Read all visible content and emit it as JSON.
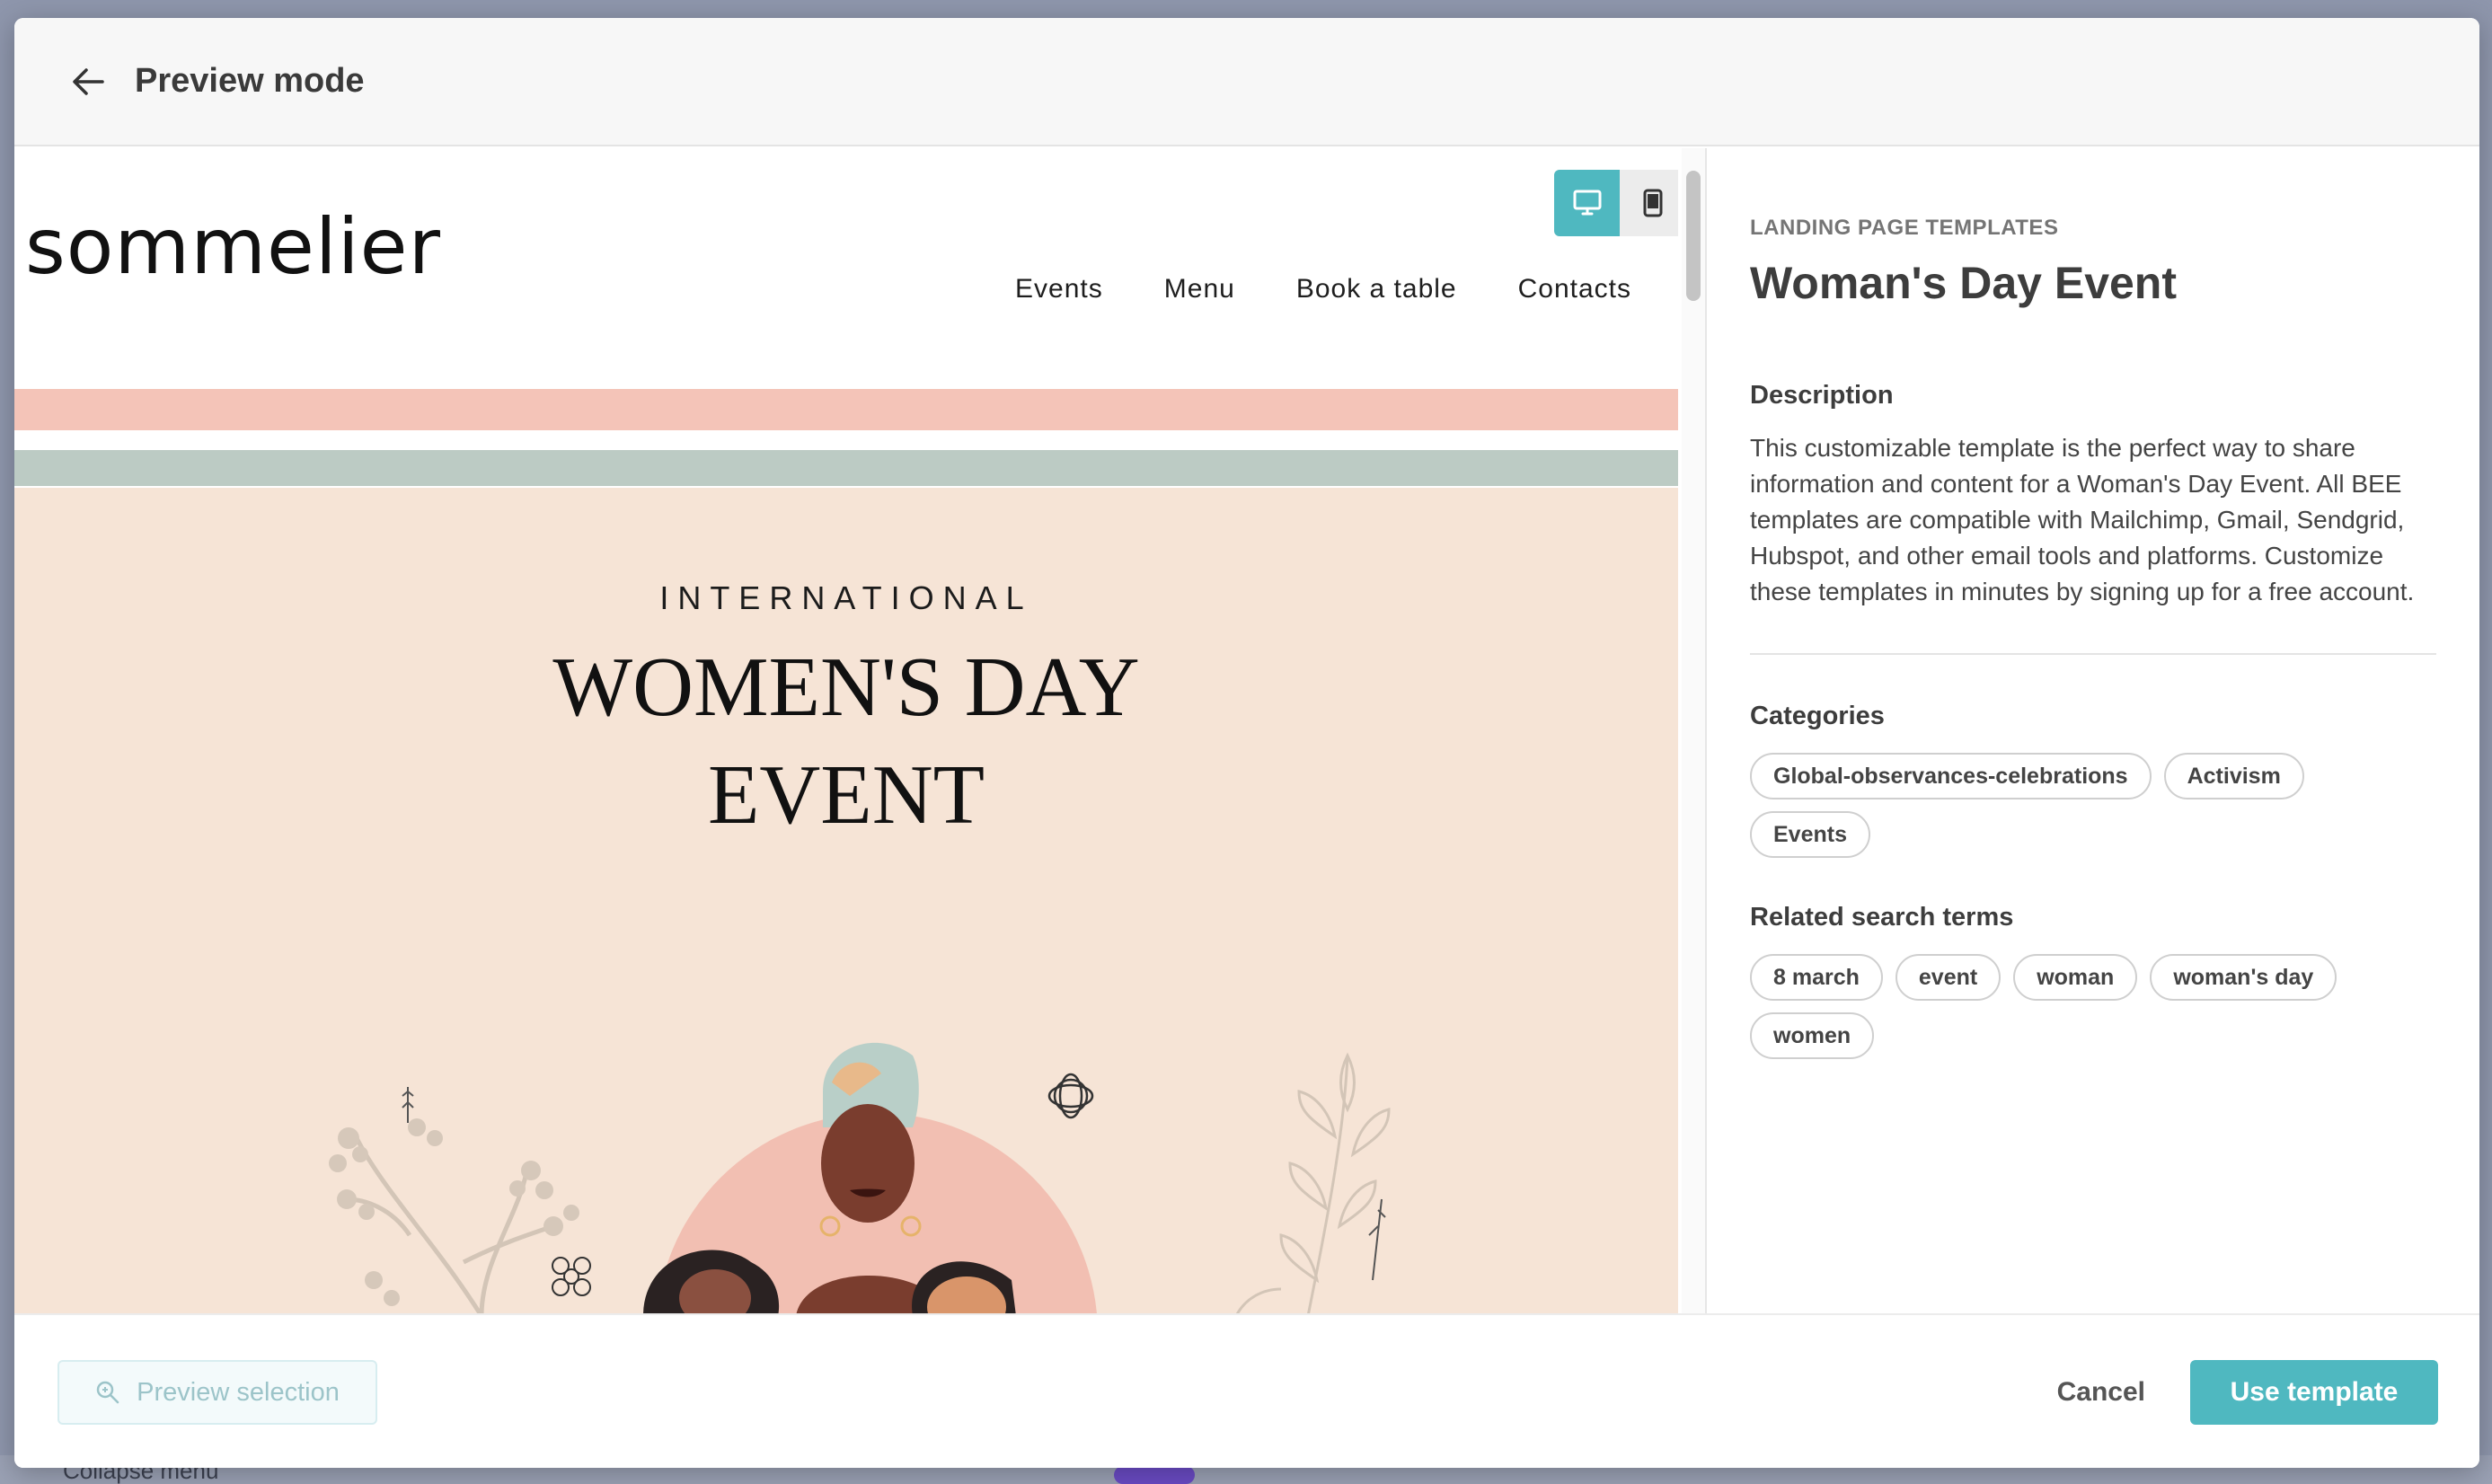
{
  "background": {
    "collapse_label": "Collapse menu"
  },
  "header": {
    "title": "Preview mode"
  },
  "preview": {
    "logo": "sommelier",
    "nav": [
      "Events",
      "Menu",
      "Book a table",
      "Contacts"
    ],
    "hero_sup": "INTERNATIONAL",
    "hero_title_line1": "WOMEN'S DAY",
    "hero_title_line2": "EVENT",
    "device_modes": [
      "desktop",
      "mobile"
    ],
    "active_device": "desktop"
  },
  "info": {
    "eyebrow": "LANDING PAGE TEMPLATES",
    "title": "Woman's Day Event",
    "description_label": "Description",
    "description": "This customizable template is the perfect way to share information and content for a Woman's Day Event. All BEE templates are compatible with Mailchimp, Gmail, Sendgrid, Hubspot, and other email tools and platforms. Customize these templates in minutes by signing up for a free account.",
    "categories_label": "Categories",
    "categories": [
      "Global-observances-celebrations",
      "Activism",
      "Events"
    ],
    "terms_label": "Related search terms",
    "terms": [
      "8 march",
      "event",
      "woman",
      "woman's day",
      "women"
    ]
  },
  "footer": {
    "preview_selection": "Preview selection",
    "cancel": "Cancel",
    "use_template": "Use template"
  },
  "colors": {
    "accent": "#4fb8c0",
    "stripe_pink": "#f4c4b8",
    "stripe_green": "#bccbc4",
    "hero_bg": "#f6e4d6"
  }
}
